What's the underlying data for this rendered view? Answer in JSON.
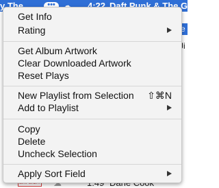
{
  "background": {
    "selected_row": {
      "title_fragment": "y The...",
      "dots": "•••",
      "time": "4:22",
      "artist": "Daft Punk & The Glitc"
    },
    "side_edge": [
      "e",
      "Ji"
    ],
    "bottom_row": {
      "badge": "EXPLICIT",
      "time": "1:49",
      "artist": "Dane Cook"
    }
  },
  "menu": {
    "items": [
      {
        "label": "Get Info"
      },
      {
        "label": "Rating",
        "submenu": true
      },
      {
        "label": "Get Album Artwork"
      },
      {
        "label": "Clear Downloaded Artwork"
      },
      {
        "label": "Reset Plays"
      },
      {
        "label": "New Playlist from Selection",
        "shortcut": "⇧⌘N"
      },
      {
        "label": "Add to Playlist",
        "submenu": true
      },
      {
        "label": "Copy"
      },
      {
        "label": "Delete"
      },
      {
        "label": "Uncheck Selection"
      },
      {
        "label": "Apply Sort Field",
        "submenu": true
      }
    ]
  },
  "colors": {
    "selection": "#2f6fd6",
    "menu_bg": "#f3f3f3",
    "explicit": "#d23b3b"
  }
}
